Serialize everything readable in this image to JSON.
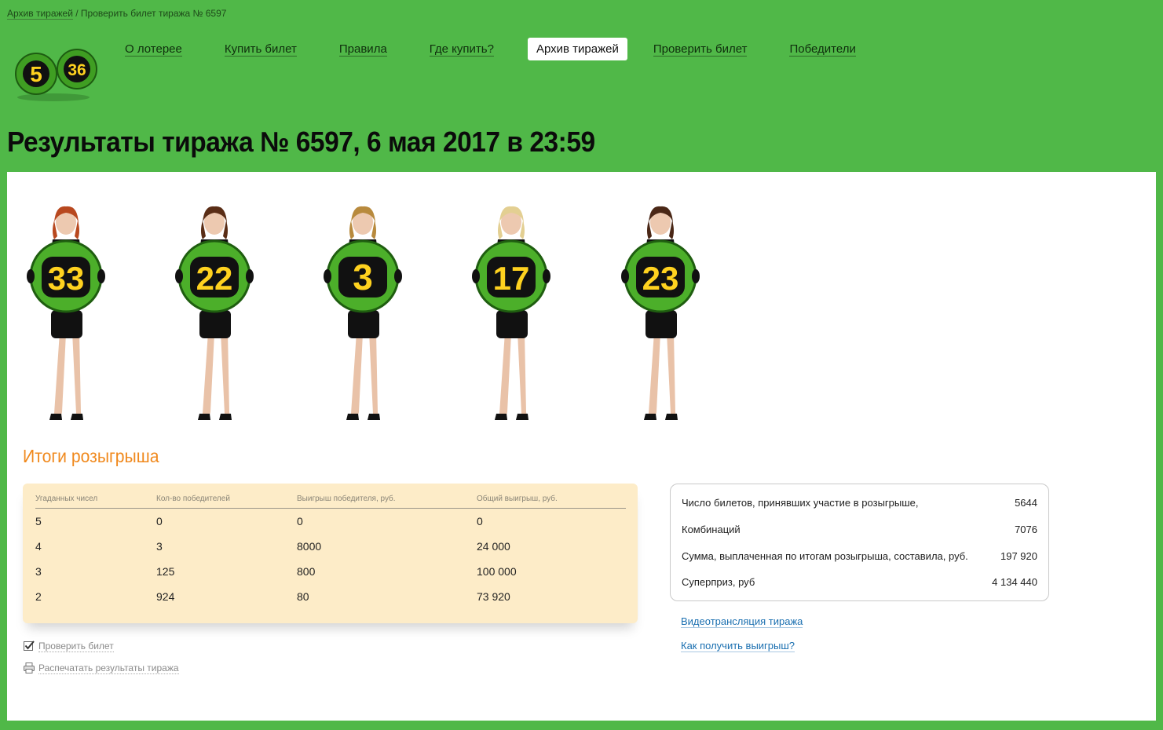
{
  "breadcrumb": {
    "archive": "Архив тиражей",
    "separator": " / ",
    "current": "Проверить билет тиража № 6597"
  },
  "logo": {
    "ball1": "5",
    "ball2": "36"
  },
  "nav": {
    "items": [
      {
        "label": "О лотерее"
      },
      {
        "label": "Купить билет"
      },
      {
        "label": "Правила"
      },
      {
        "label": "Где купить?"
      },
      {
        "label": "Архив тиражей",
        "active": true
      },
      {
        "label": "Проверить билет"
      },
      {
        "label": "Победители"
      }
    ]
  },
  "page_title": "Результаты тиража № 6597, 6 мая 2017 в 23:59",
  "balls": [
    "33",
    "22",
    "3",
    "17",
    "23"
  ],
  "results": {
    "title": "Итоги розыгрыша",
    "headers": [
      "Угаданных чисел",
      "Кол-во победителей",
      "Выигрыш победителя, руб.",
      "Общий выигрыш, руб."
    ],
    "rows": [
      [
        "5",
        "0",
        "0",
        "0"
      ],
      [
        "4",
        "3",
        "8000",
        "24 000"
      ],
      [
        "3",
        "125",
        "800",
        "100 000"
      ],
      [
        "2",
        "924",
        "80",
        "73 920"
      ]
    ]
  },
  "actions": {
    "check": "Проверить билет",
    "print": "Распечатать результаты тиража"
  },
  "stats": [
    {
      "label": "Число билетов, принявших участие в розыгрыше,",
      "value": "5644"
    },
    {
      "label": "Комбинаций",
      "value": "7076"
    },
    {
      "label": "Сумма, выплаченная по итогам розыгрыша, составила, руб.",
      "value": "197 920"
    },
    {
      "label": "Суперприз, руб",
      "value": "4 134 440"
    }
  ],
  "links": {
    "video": "Видеотрансляция тиража",
    "how_to_get": "Как получить выигрыш?"
  },
  "colors": {
    "background": "#50b848",
    "accent_orange": "#f0891d",
    "link_blue": "#1a6fb0",
    "ball_green": "#4caf2a",
    "ball_number": "#ffd21f"
  }
}
